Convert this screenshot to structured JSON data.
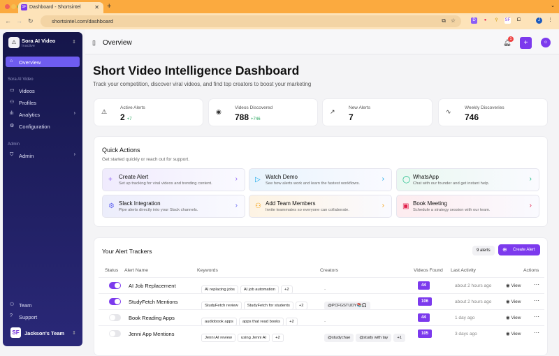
{
  "browser": {
    "tab_title": "Dashboard - Shortsintel",
    "url": "shortsintel.com/dashboard"
  },
  "sidebar": {
    "workspace": "Sora AI Video",
    "workspace_status": "Inactive",
    "overview": "Overview",
    "section1": "Sora AI Video",
    "items": [
      {
        "label": "Videos",
        "icon": "video-icon"
      },
      {
        "label": "Profiles",
        "icon": "users-icon"
      },
      {
        "label": "Analytics",
        "icon": "chart-icon"
      },
      {
        "label": "Configuration",
        "icon": "gear-icon"
      }
    ],
    "section2": "Admin",
    "admin": "Admin",
    "team": "Team",
    "support": "Support",
    "team_initials": "SF",
    "team_name": "Jackson's Team"
  },
  "header": {
    "title": "Overview",
    "notification_count": "1"
  },
  "page": {
    "title": "Short Video Intelligence Dashboard",
    "subtitle": "Track your competition, discover viral videos, and find top creators to boost your marketing"
  },
  "stats": [
    {
      "label": "Active Alerts",
      "value": "2",
      "delta": "+7"
    },
    {
      "label": "Videos Discovered",
      "value": "788",
      "delta": "+746"
    },
    {
      "label": "New Alerts",
      "value": "7",
      "delta": ""
    },
    {
      "label": "Weekly Discoveries",
      "value": "746",
      "delta": ""
    }
  ],
  "quick_actions": {
    "title": "Quick Actions",
    "subtitle": "Get started quickly or reach out for support.",
    "items": [
      {
        "title": "Create Alert",
        "desc": "Set up tracking for viral videos and trending content.",
        "color": "#8b5cf6"
      },
      {
        "title": "Watch Demo",
        "desc": "See how alerts work and learn the fastest workflows.",
        "color": "#0ea5e9"
      },
      {
        "title": "WhatsApp",
        "desc": "Chat with our founder and get instant help.",
        "color": "#10b981"
      },
      {
        "title": "Slack Integration",
        "desc": "Pipe alerts directly into your Slack channels.",
        "color": "#6366f1"
      },
      {
        "title": "Add Team Members",
        "desc": "Invite teammates so everyone can collaborate.",
        "color": "#f59e0b"
      },
      {
        "title": "Book Meeting",
        "desc": "Schedule a strategy session with our team.",
        "color": "#e11d48"
      }
    ]
  },
  "trackers": {
    "title": "Your Alert Trackers",
    "count": "9 alerts",
    "create": "Create Alert",
    "columns": [
      "Status",
      "Alert Name",
      "Keywords",
      "Creators",
      "Videos Found",
      "Last Activity",
      "Actions"
    ],
    "rows": [
      {
        "on": true,
        "name": "AI Job Replacement",
        "keywords": [
          "AI replacing jobs",
          "AI job automation",
          "+2"
        ],
        "creators": [
          "-"
        ],
        "videos": "44",
        "activity": "about 2 hours ago"
      },
      {
        "on": true,
        "name": "StudyFetch Mentions",
        "keywords": [
          "StudyFetch review",
          "StudyFetch for students",
          "+2"
        ],
        "creators": [
          "@PCFGSTUDY📚🎧"
        ],
        "videos": "106",
        "activity": "about 2 hours ago"
      },
      {
        "on": false,
        "name": "Book Reading Apps",
        "keywords": [
          "audiobook apps",
          "apps that read books",
          "+2"
        ],
        "creators": [
          "-"
        ],
        "videos": "44",
        "activity": "1 day ago"
      },
      {
        "on": false,
        "name": "Jenni App Mentions",
        "keywords": [
          "Jenni AI review",
          "using Jenni AI",
          "+2"
        ],
        "creators": [
          "@studychae",
          "@study with tay",
          "+1"
        ],
        "videos": "105",
        "activity": "3 days ago"
      }
    ],
    "view": "View"
  },
  "colors": {
    "accent": "#7c3aed",
    "sidebar": "#1c1c5a",
    "browser": "#fbaa3f"
  }
}
